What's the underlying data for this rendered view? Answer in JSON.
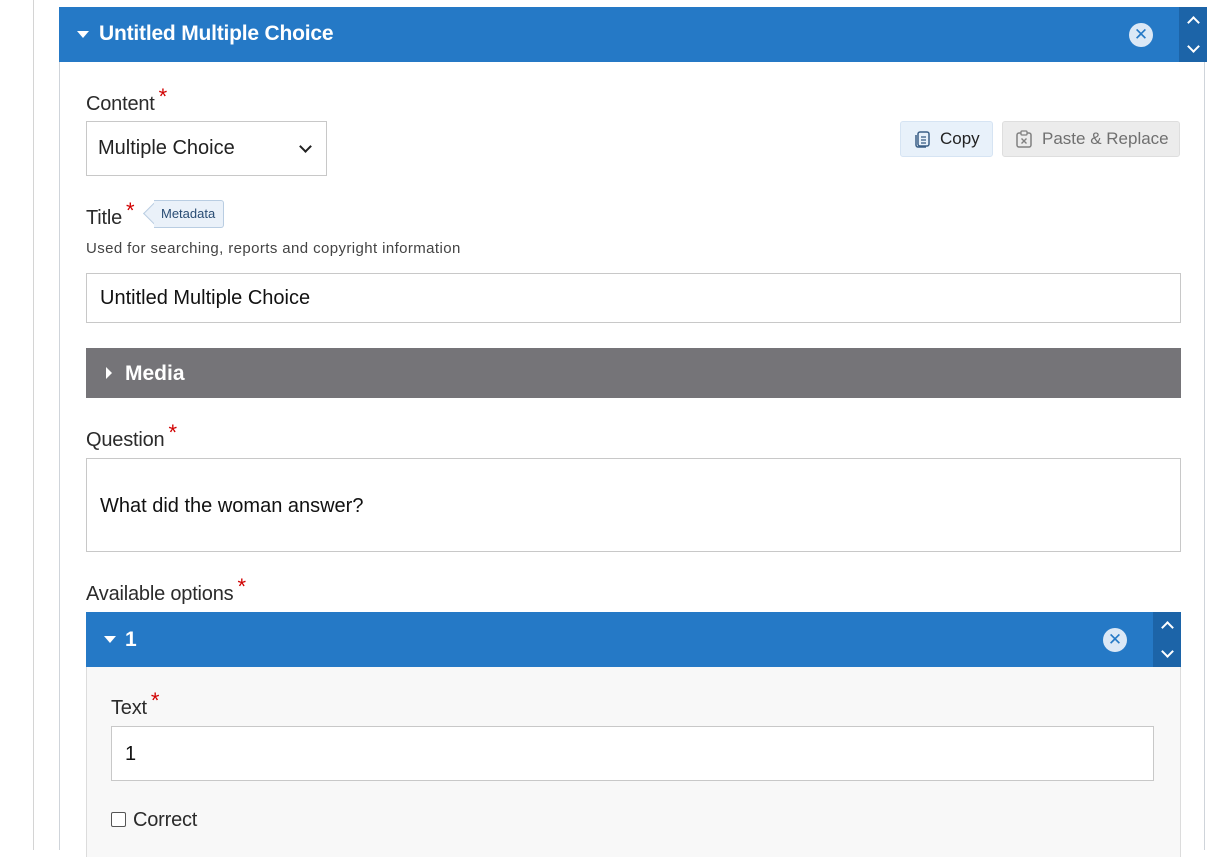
{
  "item_header": {
    "title": "Untitled Multiple Choice"
  },
  "content_field": {
    "label": "Content",
    "selected": "Multiple Choice"
  },
  "toolbar": {
    "copy_label": "Copy",
    "paste_label": "Paste & Replace"
  },
  "title_field": {
    "label": "Title",
    "tag": "Metadata",
    "description": "Used for searching, reports and copyright information",
    "value": "Untitled Multiple Choice"
  },
  "media_section": {
    "label": "Media"
  },
  "question_field": {
    "label": "Question",
    "value": "What did the woman answer?"
  },
  "options_field": {
    "label": "Available options"
  },
  "option_1": {
    "header": "1",
    "text_label": "Text",
    "text_value": "1",
    "correct_label": "Correct",
    "correct_checked": false
  },
  "required_mark": "*",
  "remove_symbol": "✕",
  "colors": {
    "header_blue": "#2579c6",
    "order_blue": "#1c64a8",
    "media_gray": "#757478",
    "required_red": "#d10000"
  }
}
